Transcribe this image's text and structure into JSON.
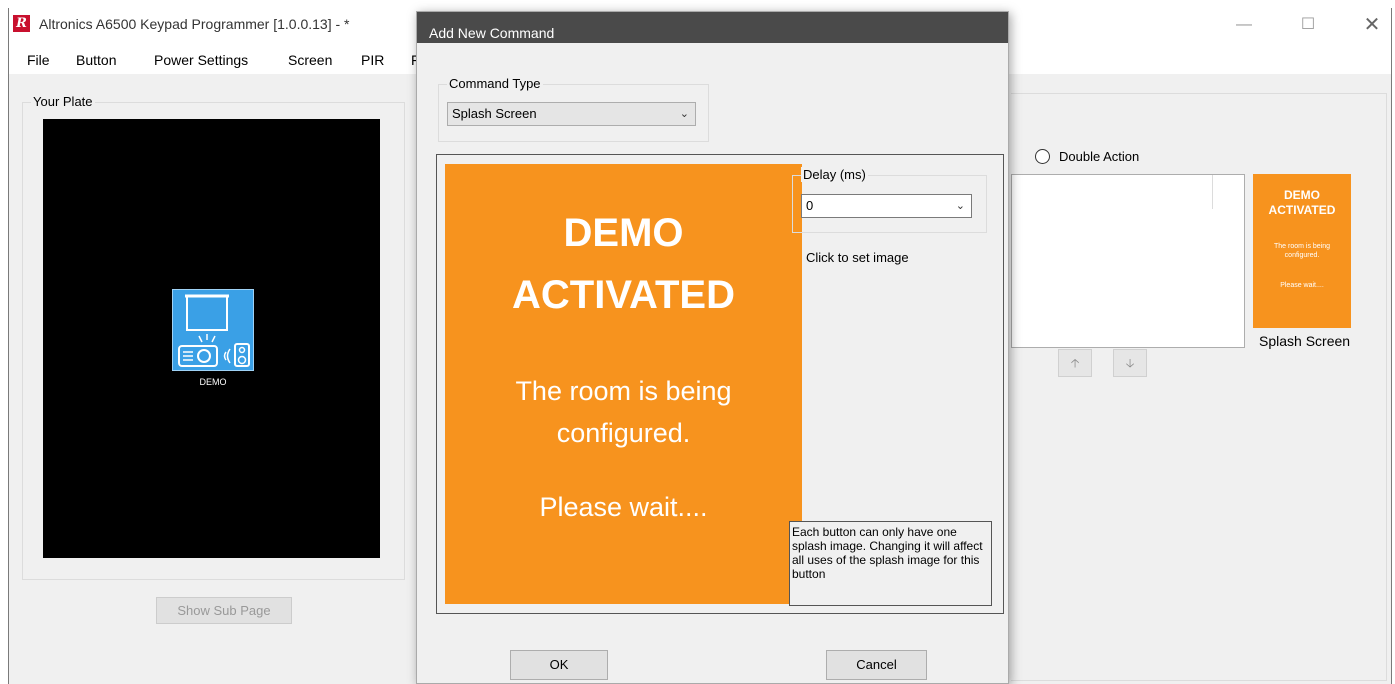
{
  "app": {
    "title": "Altronics A6500 Keypad Programmer [1.0.0.13]  - *",
    "icon_letter": "R",
    "window_controls": {
      "minimize": "—",
      "maximize": "☐",
      "close": "✕"
    }
  },
  "menu": {
    "items": [
      "File",
      "Button",
      "Power Settings",
      "Screen",
      "PIR",
      "F"
    ]
  },
  "plate": {
    "group_title": "Your Plate",
    "button_label": "DEMO",
    "show_sub_page": "Show Sub Page"
  },
  "right_panel": {
    "double_action": "Double Action",
    "up_arrow": "🡡",
    "down_arrow": "🡣",
    "thumb": {
      "line1": "DEMO",
      "line2": "ACTIVATED",
      "line3": "The room is being",
      "line4": "configured.",
      "line5": "Please wait...."
    },
    "thumb_label": "Splash Screen"
  },
  "dialog": {
    "title": "Add New Command",
    "command_type": {
      "label": "Command Type",
      "value": "Splash Screen"
    },
    "splash": {
      "line1": "DEMO",
      "line2": "ACTIVATED",
      "line3": "The room is being",
      "line4": "configured.",
      "line5": "Please wait...."
    },
    "delay": {
      "label": "Delay (ms)",
      "value": "0"
    },
    "click_to_set": "Click to set image",
    "note": "Each button can only have one splash image. Changing it will affect all uses of the splash image for this button",
    "ok": "OK",
    "cancel": "Cancel"
  },
  "colors": {
    "splash_orange": "#f7931e",
    "dialog_titlebar": "#4a4a4a",
    "plate_button_blue": "#3aa0e6",
    "app_icon_red": "#c8102e"
  }
}
